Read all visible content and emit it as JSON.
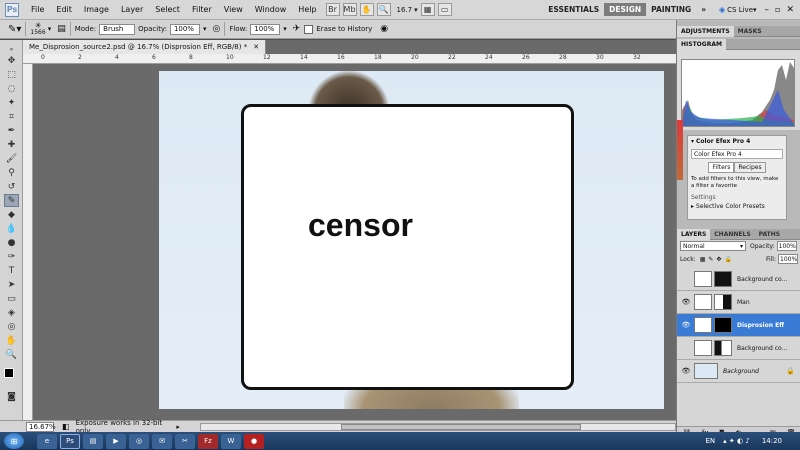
{
  "app": {
    "logo": "Ps",
    "menu": [
      "File",
      "Edit",
      "Image",
      "Layer",
      "Select",
      "Filter",
      "View",
      "Window",
      "Help"
    ],
    "zoom_display": "16.7",
    "workspaces": [
      "ESSENTIALS",
      "DESIGN",
      "PAINTING"
    ],
    "active_workspace": "DESIGN",
    "more": "»",
    "cs_live": "CS Live"
  },
  "options": {
    "brush_size": "1566",
    "mode_label": "Mode:",
    "mode_value": "Brush",
    "opacity_label": "Opacity:",
    "opacity_value": "100%",
    "flow_label": "Flow:",
    "flow_value": "100%",
    "erase_to_history": "Erase to History"
  },
  "document": {
    "tab_title": "Me_Disprosion_source2.psd @ 16.7% (Disprosion Eff, RGB/8) *",
    "ruler_ticks": [
      "0",
      "2",
      "4",
      "6",
      "8",
      "10",
      "12",
      "14",
      "16",
      "18",
      "20",
      "22",
      "24",
      "26",
      "28",
      "30",
      "32"
    ],
    "overlay_text": "censor",
    "status_zoom": "16.67%",
    "status_text": "Exposure works in 32-bit only"
  },
  "panels": {
    "top_tabs": [
      "ADJUSTMENTS",
      "MASKS"
    ],
    "histogram_tab": "HISTOGRAM",
    "cefx_title": "Color Efex Pro 4",
    "cefx_field": "Color Efex Pro 4",
    "cefx_tabs": [
      "Filters",
      "Recipes"
    ],
    "cefx_note": "To add filters to this view, make a filter a favorite",
    "cefx_settings": "Settings",
    "cefx_preset": "Selective Color Presets",
    "layer_tabs": [
      "LAYERS",
      "CHANNELS",
      "PATHS"
    ],
    "blend_mode": "Normal",
    "opacity_label": "Opacity:",
    "opacity_value": "100%",
    "lock_label": "Lock:",
    "fill_label": "Fill:",
    "fill_value": "100%",
    "layers": [
      {
        "name": "Background co...",
        "selected": false,
        "visible": false
      },
      {
        "name": "Man",
        "selected": false,
        "visible": true
      },
      {
        "name": "Disprosion Eff",
        "selected": true,
        "visible": true
      },
      {
        "name": "Background co...",
        "selected": false,
        "visible": false
      },
      {
        "name": "Background",
        "selected": false,
        "visible": true
      }
    ]
  },
  "taskbar": {
    "lang": "EN",
    "time": "14:20"
  }
}
